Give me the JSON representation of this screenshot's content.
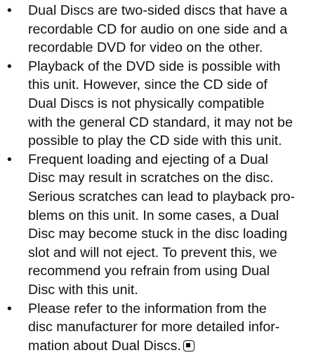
{
  "bullets": [
    {
      "lines": [
        "Dual Discs are two-sided discs that have a",
        "recordable CD for audio on one side and a",
        "recordable DVD for video on the other."
      ]
    },
    {
      "lines": [
        "Playback of the DVD side is possible with",
        "this unit. However, since the CD side of",
        "Dual Discs is not physically compatible",
        "with the general CD standard, it may not be",
        "possible to play the CD side with this unit."
      ]
    },
    {
      "lines": [
        "Frequent loading and ejecting of a Dual",
        "Disc may result in scratches on the disc.",
        "Serious scratches can lead to playback pro-",
        "blems on this unit. In some cases, a Dual",
        "Disc may become stuck in the disc loading",
        "slot and will not eject. To prevent this, we",
        "recommend you refrain from using Dual",
        "Disc with this unit."
      ]
    },
    {
      "lines": [
        "Please refer to the information from the",
        "disc manufacturer for more detailed infor-",
        "mation about Dual Discs."
      ]
    }
  ],
  "bullet_symbol": "•",
  "end_mark_icon": "end-of-section-square-icon"
}
